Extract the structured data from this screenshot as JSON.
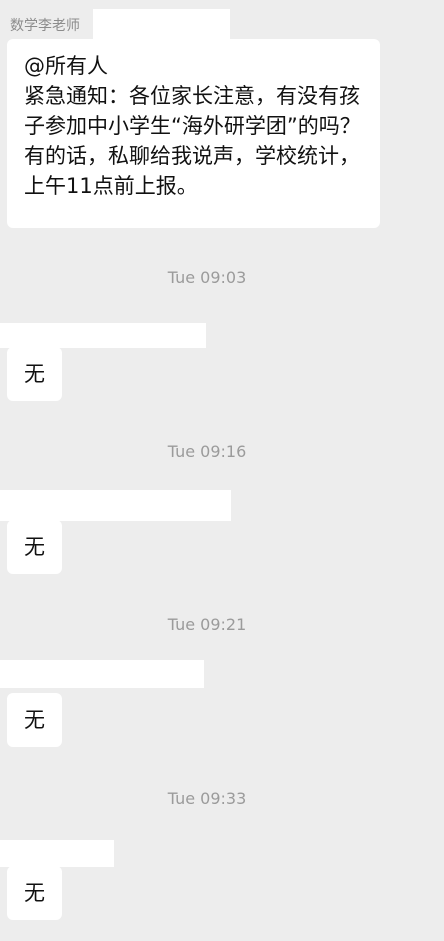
{
  "theme": {
    "background": "#ededed",
    "bubble": "#ffffff",
    "timestamp_color": "#9b9b9b"
  },
  "first_message": {
    "sender_name": "数学李老师",
    "mention": "@所有人",
    "body": "紧急通知：各位家长注意，有没有孩子参加中小学生“海外研学团”的吗？有的话，私聊给我说声，学校统计，上午11点前上报。"
  },
  "replies": [
    {
      "time": "Tue 09:03",
      "text": "无"
    },
    {
      "time": "Tue 09:16",
      "text": "无"
    },
    {
      "time": "Tue 09:21",
      "text": "无"
    },
    {
      "time": "Tue 09:33",
      "text": "无"
    }
  ]
}
